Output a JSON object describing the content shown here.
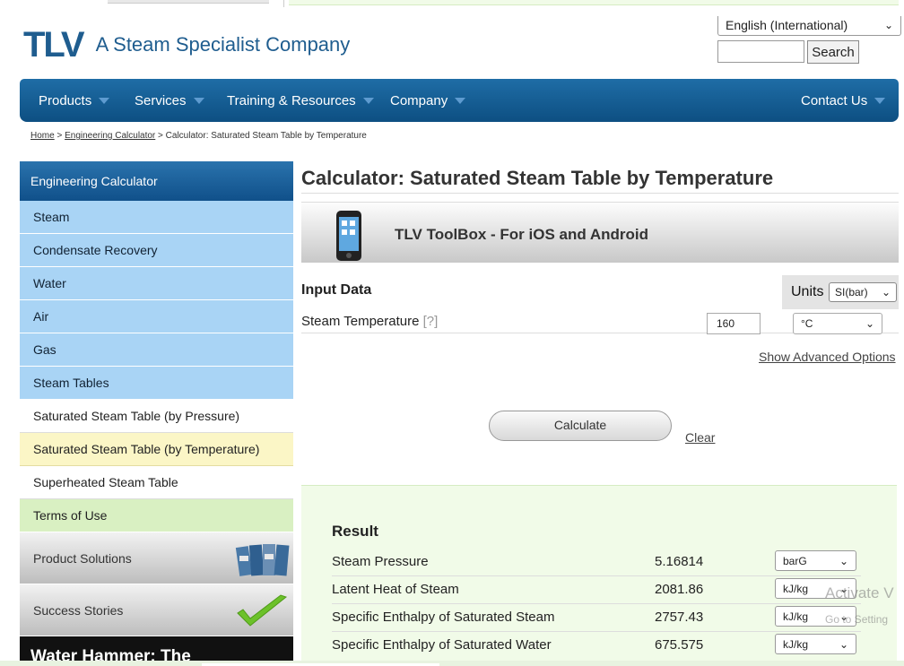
{
  "header": {
    "logo_mark": "TLV",
    "tagline": "A Steam Specialist Company",
    "language": "English (International)",
    "search_button": "Search"
  },
  "nav": {
    "products": "Products",
    "services": "Services",
    "training": "Training & Resources",
    "company": "Company",
    "contact": "Contact Us"
  },
  "breadcrumb": {
    "home": "Home",
    "sep1": ">",
    "engineering": "Engineering Calculator",
    "sep2": ">",
    "current": "Calculator: Saturated Steam Table by Temperature"
  },
  "sidebar": {
    "header": "Engineering Calculator",
    "items": [
      {
        "label": "Steam"
      },
      {
        "label": "Condensate Recovery"
      },
      {
        "label": "Water"
      },
      {
        "label": "Air"
      },
      {
        "label": "Gas"
      },
      {
        "label": "Steam Tables"
      },
      {
        "label": "Saturated Steam Table (by Pressure)"
      },
      {
        "label": "Saturated Steam Table (by Temperature)"
      },
      {
        "label": "Superheated Steam Table"
      },
      {
        "label": "Terms of Use"
      }
    ],
    "promo1": "Product Solutions",
    "promo2": "Success Stories",
    "promo3": "Water Hammer: The"
  },
  "main": {
    "title": "Calculator: Saturated Steam Table by Temperature",
    "toolbox": "TLV ToolBox - For iOS and Android",
    "input_data": "Input Data",
    "units_label": "Units",
    "units_value": "SI(bar)",
    "steam_temp_label": "Steam Temperature",
    "help": "[?]",
    "temp_value": "160",
    "temp_unit": "°C",
    "advanced": "Show Advanced Options",
    "calculate": "Calculate",
    "clear": "Clear"
  },
  "result": {
    "title": "Result",
    "rows": [
      {
        "label": "Steam Pressure",
        "value": "5.16814",
        "unit": "barG"
      },
      {
        "label": "Latent Heat of Steam",
        "value": "2081.86",
        "unit": "kJ/kg"
      },
      {
        "label": "Specific Enthalpy of Saturated Steam",
        "value": "2757.43",
        "unit": "kJ/kg"
      },
      {
        "label": "Specific Enthalpy of Saturated Water",
        "value": "675.575",
        "unit": "kJ/kg"
      }
    ]
  },
  "overlay": {
    "watermark_line1": "Activate V",
    "watermark_line2": "Go to Setting"
  },
  "colors": {
    "brand_blue": "#1f5d8f",
    "sidebar_blue": "#a9d4f5",
    "result_green": "#f1fbe8"
  }
}
